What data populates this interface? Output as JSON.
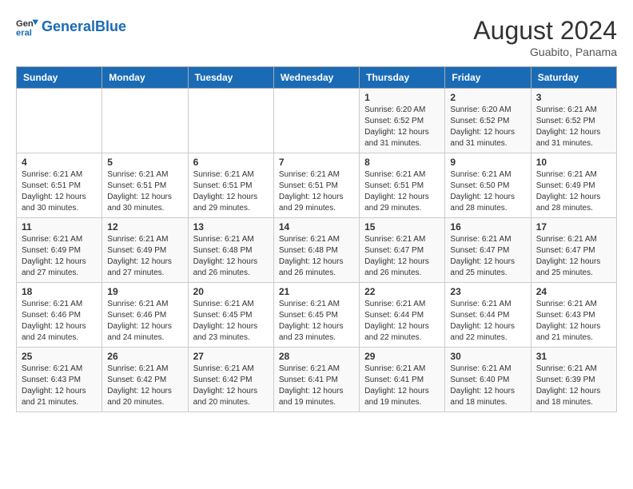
{
  "header": {
    "logo_general": "General",
    "logo_blue": "Blue",
    "month_year": "August 2024",
    "location": "Guabito, Panama"
  },
  "days_of_week": [
    "Sunday",
    "Monday",
    "Tuesday",
    "Wednesday",
    "Thursday",
    "Friday",
    "Saturday"
  ],
  "weeks": [
    [
      {
        "day": "",
        "info": ""
      },
      {
        "day": "",
        "info": ""
      },
      {
        "day": "",
        "info": ""
      },
      {
        "day": "",
        "info": ""
      },
      {
        "day": "1",
        "info": "Sunrise: 6:20 AM\nSunset: 6:52 PM\nDaylight: 12 hours\nand 31 minutes."
      },
      {
        "day": "2",
        "info": "Sunrise: 6:20 AM\nSunset: 6:52 PM\nDaylight: 12 hours\nand 31 minutes."
      },
      {
        "day": "3",
        "info": "Sunrise: 6:21 AM\nSunset: 6:52 PM\nDaylight: 12 hours\nand 31 minutes."
      }
    ],
    [
      {
        "day": "4",
        "info": "Sunrise: 6:21 AM\nSunset: 6:51 PM\nDaylight: 12 hours\nand 30 minutes."
      },
      {
        "day": "5",
        "info": "Sunrise: 6:21 AM\nSunset: 6:51 PM\nDaylight: 12 hours\nand 30 minutes."
      },
      {
        "day": "6",
        "info": "Sunrise: 6:21 AM\nSunset: 6:51 PM\nDaylight: 12 hours\nand 29 minutes."
      },
      {
        "day": "7",
        "info": "Sunrise: 6:21 AM\nSunset: 6:51 PM\nDaylight: 12 hours\nand 29 minutes."
      },
      {
        "day": "8",
        "info": "Sunrise: 6:21 AM\nSunset: 6:51 PM\nDaylight: 12 hours\nand 29 minutes."
      },
      {
        "day": "9",
        "info": "Sunrise: 6:21 AM\nSunset: 6:50 PM\nDaylight: 12 hours\nand 28 minutes."
      },
      {
        "day": "10",
        "info": "Sunrise: 6:21 AM\nSunset: 6:49 PM\nDaylight: 12 hours\nand 28 minutes."
      }
    ],
    [
      {
        "day": "11",
        "info": "Sunrise: 6:21 AM\nSunset: 6:49 PM\nDaylight: 12 hours\nand 27 minutes."
      },
      {
        "day": "12",
        "info": "Sunrise: 6:21 AM\nSunset: 6:49 PM\nDaylight: 12 hours\nand 27 minutes."
      },
      {
        "day": "13",
        "info": "Sunrise: 6:21 AM\nSunset: 6:48 PM\nDaylight: 12 hours\nand 26 minutes."
      },
      {
        "day": "14",
        "info": "Sunrise: 6:21 AM\nSunset: 6:48 PM\nDaylight: 12 hours\nand 26 minutes."
      },
      {
        "day": "15",
        "info": "Sunrise: 6:21 AM\nSunset: 6:47 PM\nDaylight: 12 hours\nand 26 minutes."
      },
      {
        "day": "16",
        "info": "Sunrise: 6:21 AM\nSunset: 6:47 PM\nDaylight: 12 hours\nand 25 minutes."
      },
      {
        "day": "17",
        "info": "Sunrise: 6:21 AM\nSunset: 6:47 PM\nDaylight: 12 hours\nand 25 minutes."
      }
    ],
    [
      {
        "day": "18",
        "info": "Sunrise: 6:21 AM\nSunset: 6:46 PM\nDaylight: 12 hours\nand 24 minutes."
      },
      {
        "day": "19",
        "info": "Sunrise: 6:21 AM\nSunset: 6:46 PM\nDaylight: 12 hours\nand 24 minutes."
      },
      {
        "day": "20",
        "info": "Sunrise: 6:21 AM\nSunset: 6:45 PM\nDaylight: 12 hours\nand 23 minutes."
      },
      {
        "day": "21",
        "info": "Sunrise: 6:21 AM\nSunset: 6:45 PM\nDaylight: 12 hours\nand 23 minutes."
      },
      {
        "day": "22",
        "info": "Sunrise: 6:21 AM\nSunset: 6:44 PM\nDaylight: 12 hours\nand 22 minutes."
      },
      {
        "day": "23",
        "info": "Sunrise: 6:21 AM\nSunset: 6:44 PM\nDaylight: 12 hours\nand 22 minutes."
      },
      {
        "day": "24",
        "info": "Sunrise: 6:21 AM\nSunset: 6:43 PM\nDaylight: 12 hours\nand 21 minutes."
      }
    ],
    [
      {
        "day": "25",
        "info": "Sunrise: 6:21 AM\nSunset: 6:43 PM\nDaylight: 12 hours\nand 21 minutes."
      },
      {
        "day": "26",
        "info": "Sunrise: 6:21 AM\nSunset: 6:42 PM\nDaylight: 12 hours\nand 20 minutes."
      },
      {
        "day": "27",
        "info": "Sunrise: 6:21 AM\nSunset: 6:42 PM\nDaylight: 12 hours\nand 20 minutes."
      },
      {
        "day": "28",
        "info": "Sunrise: 6:21 AM\nSunset: 6:41 PM\nDaylight: 12 hours\nand 19 minutes."
      },
      {
        "day": "29",
        "info": "Sunrise: 6:21 AM\nSunset: 6:41 PM\nDaylight: 12 hours\nand 19 minutes."
      },
      {
        "day": "30",
        "info": "Sunrise: 6:21 AM\nSunset: 6:40 PM\nDaylight: 12 hours\nand 18 minutes."
      },
      {
        "day": "31",
        "info": "Sunrise: 6:21 AM\nSunset: 6:39 PM\nDaylight: 12 hours\nand 18 minutes."
      }
    ]
  ]
}
